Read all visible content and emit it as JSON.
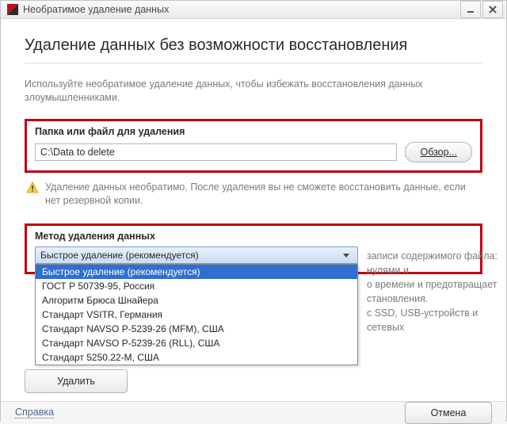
{
  "window": {
    "title": "Необратимое удаление данных"
  },
  "heading": "Удаление данных без возможности восстановления",
  "subtext": "Используйте необратимое удаление данных, чтобы избежать восстановления данных злоумышленниками.",
  "path_section": {
    "label": "Папка или файл для удаления",
    "value": "C:\\Data to delete",
    "browse_label": "Обзор..."
  },
  "warning_text": "Удаление данных необратимо. После удаления вы не сможете восстановить данные, если нет резервной копии.",
  "method_section": {
    "label": "Метод удаления данных",
    "selected": "Быстрое удаление (рекомендуется)",
    "options": [
      "Быстрое удаление (рекомендуется)",
      "ГОСТ Р 50739-95, Россия",
      "Алгоритм Брюса Шнайера",
      "Стандарт VSITR, Германия",
      "Стандарт NAVSO P-5239-26 (MFM), США",
      "Стандарт NAVSO P-5239-26 (RLL), США",
      "Стандарт 5250.22-M, США"
    ],
    "description_fragments": [
      "записи содержимого файла: нулями и",
      "о времени и предотвращает",
      "становления.",
      "с SSD, USB-устройств и сетевых"
    ]
  },
  "delete_button": "Удалить",
  "footer": {
    "help": "Справка",
    "cancel": "Отмена"
  }
}
